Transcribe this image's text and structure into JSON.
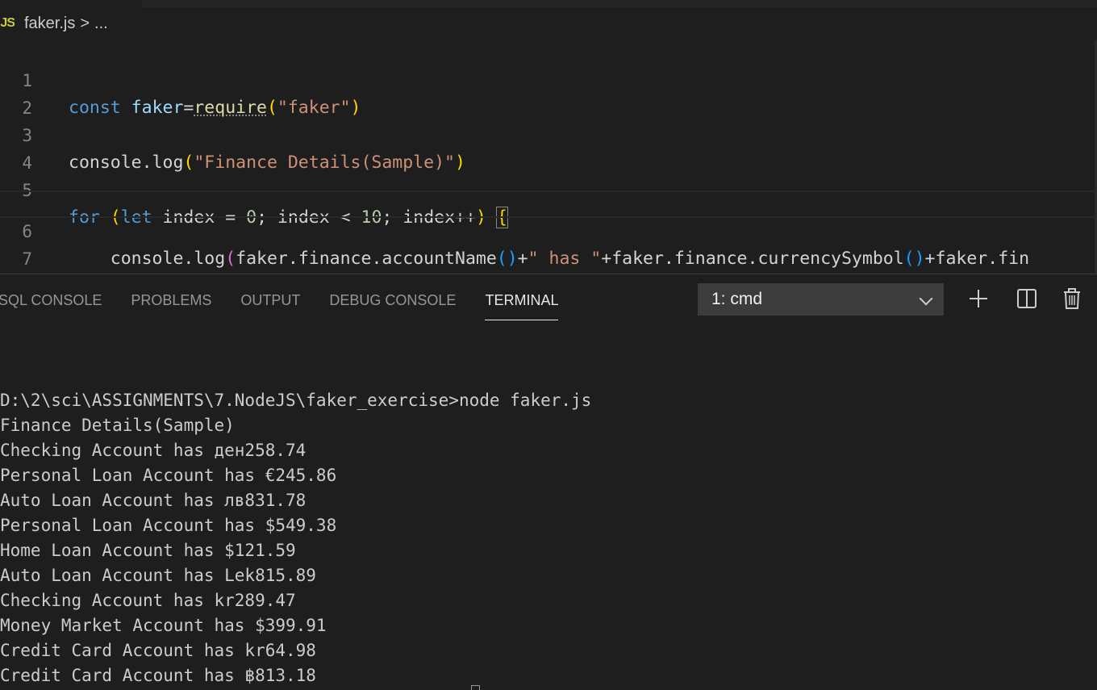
{
  "breadcrumb": {
    "lang_badge": "JS",
    "file": "faker.js",
    "separator": ">",
    "ellipsis": "..."
  },
  "editor": {
    "line_numbers": [
      "1",
      "2",
      "3",
      "4",
      "5",
      "6",
      "7"
    ],
    "line1": {
      "kw": "const",
      "var": " faker",
      "op": "=",
      "fn": "require",
      "open": "(",
      "str": "\"faker\"",
      "close": ")"
    },
    "line3": {
      "obj": "console",
      "dot": ".",
      "fn": "log",
      "open": "(",
      "str": "\"Finance Details(Sample)\"",
      "close": ")"
    },
    "line5": {
      "kw": "for",
      "sp": " ",
      "open": "(",
      "let": "let",
      "var1": " index",
      "op1": " = ",
      "num1": "0",
      "semi1": "; ",
      "var2": "index",
      "op2": " < ",
      "num2": "10",
      "semi2": "; ",
      "var3": "index",
      "op3": "++",
      "close": ")",
      "sp2": " ",
      "brace": "{"
    },
    "line6": {
      "indent": "    ",
      "obj": "console",
      "dot": ".",
      "fn": "log",
      "open": "(",
      "v1": "faker",
      "d1": ".",
      "v2": "finance",
      "d2": ".",
      "f1": "accountName",
      "p1": "()",
      "plus1": "+",
      "str": "\" has \"",
      "plus2": "+",
      "v3": "faker",
      "d3": ".",
      "v4": "finance",
      "d4": ".",
      "f2": "currencySymbol",
      "p2": "()",
      "plus3": "+",
      "v5": "faker",
      "d5": ".",
      "v6": "fin"
    },
    "line7": {
      "brace": "}"
    }
  },
  "panel": {
    "tabs": [
      "SQL CONSOLE",
      "PROBLEMS",
      "OUTPUT",
      "DEBUG CONSOLE",
      "TERMINAL"
    ],
    "active_tab": "TERMINAL",
    "terminal_select": "1: cmd",
    "icons": [
      "plus-icon",
      "split-icon",
      "trash-icon"
    ]
  },
  "terminal": {
    "lines": [
      "",
      "D:\\2\\sci\\ASSIGNMENTS\\7.NodeJS\\faker_exercise>node faker.js",
      "Finance Details(Sample)",
      "Checking Account has ден258.74",
      "Personal Loan Account has €245.86",
      "Auto Loan Account has лв831.78",
      "Personal Loan Account has $549.38",
      "Home Loan Account has $121.59",
      "Auto Loan Account has Lek815.89",
      "Checking Account has kr289.47",
      "Money Market Account has $399.91",
      "Credit Card Account has kr64.98",
      "Credit Card Account has ฿813.18"
    ]
  }
}
